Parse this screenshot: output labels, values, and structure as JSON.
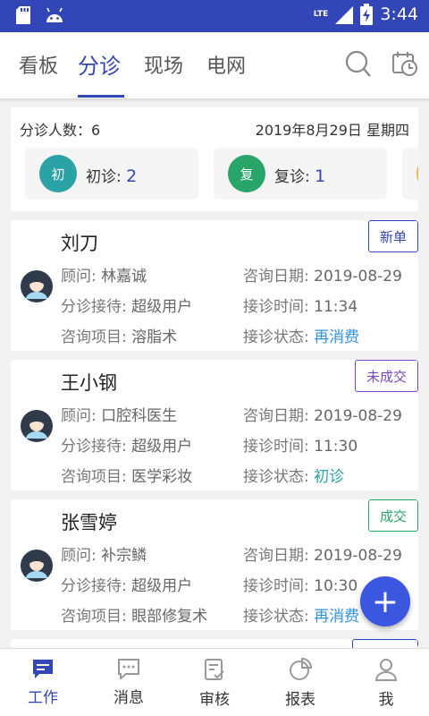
{
  "status_bar": {
    "time": "3:44",
    "network": "LTE"
  },
  "tabs": [
    {
      "label": "看板"
    },
    {
      "label": "分诊"
    },
    {
      "label": "现场"
    },
    {
      "label": "电网"
    }
  ],
  "summary": {
    "count_label": "分诊人数：6",
    "date": "2019年8月29日  星期四",
    "chips": [
      {
        "icon_text": "初",
        "label": "初诊: ",
        "value": "2",
        "color": "#2aa2a6"
      },
      {
        "icon_text": "复",
        "label": "复诊: ",
        "value": "1",
        "color": "#2aa56a"
      }
    ]
  },
  "field_labels": {
    "consultant": "顾问: ",
    "reception": "分诊接待: ",
    "project": "咨询项目: ",
    "date": "咨询日期: ",
    "time": "接诊时间: ",
    "status": "接诊状态: "
  },
  "patients": [
    {
      "name": "刘刀",
      "badge": "新单",
      "badge_color": "#3346b8",
      "consultant": "林嘉诚",
      "reception": "超级用户",
      "project": "溶脂术",
      "date": "2019-08-29",
      "time": "11:34",
      "status": "再消费"
    },
    {
      "name": "王小钢",
      "badge": "未成交",
      "badge_color": "#7a45c2",
      "consultant": "口腔科医生",
      "reception": "超级用户",
      "project": "医学彩妆",
      "date": "2019-08-29",
      "time": "11:30",
      "status": "初诊"
    },
    {
      "name": "张雪婷",
      "badge": "成交",
      "badge_color": "#2aa56a",
      "consultant": "补宗鳞",
      "reception": "超级用户",
      "project": "眼部修复术",
      "date": "2019-08-29",
      "time": "10:30",
      "status": "再消费"
    }
  ],
  "fab": {
    "label": "+"
  },
  "bottom_nav": [
    {
      "label": "工作"
    },
    {
      "label": "消息"
    },
    {
      "label": "审核"
    },
    {
      "label": "报表"
    },
    {
      "label": "我"
    }
  ],
  "colors": {
    "primary": "#3346b8",
    "status_blue": "#2f93e0",
    "status_teal": "#2aa2a6"
  }
}
